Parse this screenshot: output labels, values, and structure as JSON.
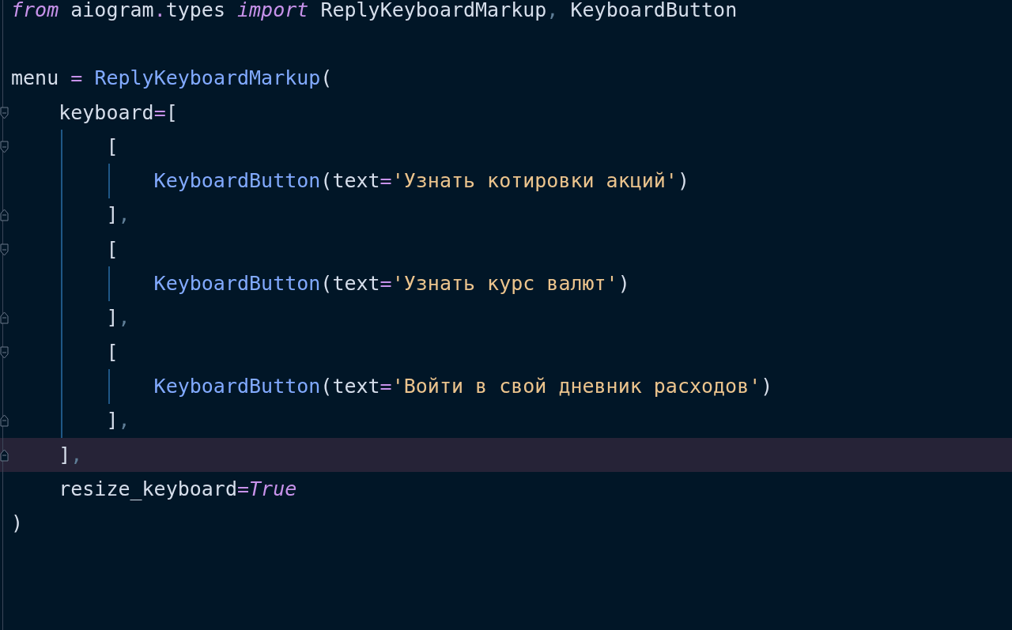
{
  "editor": {
    "lines": [
      {
        "fold_start": false,
        "fold_end": false,
        "current": false,
        "tokens": [
          {
            "kind": "keyword",
            "text": "from"
          },
          {
            "kind": "plain",
            "text": " aiogram"
          },
          {
            "kind": "op",
            "text": "."
          },
          {
            "kind": "plain",
            "text": "types "
          },
          {
            "kind": "keyword",
            "text": "import"
          },
          {
            "kind": "plain",
            "text": " ReplyKeyboardMarkup"
          },
          {
            "kind": "punct",
            "text": ","
          },
          {
            "kind": "plain",
            "text": " KeyboardButton"
          }
        ]
      },
      {
        "fold_start": false,
        "fold_end": false,
        "current": false
      },
      {
        "fold_start": false,
        "fold_end": false,
        "current": false,
        "tokens": [
          {
            "kind": "plain",
            "text": "menu "
          },
          {
            "kind": "op",
            "text": "="
          },
          {
            "kind": "func",
            "text": " ReplyKeyboardMarkup"
          },
          {
            "kind": "plain",
            "text": "("
          }
        ]
      },
      {
        "fold_start": true,
        "fold_end": false,
        "current": false,
        "tokens": [
          {
            "kind": "plain",
            "text": "    keyboard"
          },
          {
            "kind": "op",
            "text": "="
          },
          {
            "kind": "plain",
            "text": "["
          }
        ]
      },
      {
        "fold_start": true,
        "fold_end": false,
        "current": false,
        "tokens": [
          {
            "kind": "plain",
            "text": "        ["
          }
        ]
      },
      {
        "fold_start": false,
        "fold_end": false,
        "current": false,
        "tokens": [
          {
            "kind": "func",
            "text": "            KeyboardButton"
          },
          {
            "kind": "plain",
            "text": "(text"
          },
          {
            "kind": "op",
            "text": "="
          },
          {
            "kind": "string",
            "text": "'Узнать котировки акций'"
          },
          {
            "kind": "plain",
            "text": ")"
          }
        ]
      },
      {
        "fold_start": false,
        "fold_end": true,
        "current": false,
        "tokens": [
          {
            "kind": "plain",
            "text": "        ]"
          },
          {
            "kind": "punct",
            "text": ","
          }
        ]
      },
      {
        "fold_start": true,
        "fold_end": false,
        "current": false,
        "tokens": [
          {
            "kind": "plain",
            "text": "        ["
          }
        ]
      },
      {
        "fold_start": false,
        "fold_end": false,
        "current": false,
        "tokens": [
          {
            "kind": "func",
            "text": "            KeyboardButton"
          },
          {
            "kind": "plain",
            "text": "(text"
          },
          {
            "kind": "op",
            "text": "="
          },
          {
            "kind": "string",
            "text": "'Узнать курс валют'"
          },
          {
            "kind": "plain",
            "text": ")"
          }
        ]
      },
      {
        "fold_start": false,
        "fold_end": true,
        "current": false,
        "tokens": [
          {
            "kind": "plain",
            "text": "        ]"
          },
          {
            "kind": "punct",
            "text": ","
          }
        ]
      },
      {
        "fold_start": true,
        "fold_end": false,
        "current": false,
        "tokens": [
          {
            "kind": "plain",
            "text": "        ["
          }
        ]
      },
      {
        "fold_start": false,
        "fold_end": false,
        "current": false,
        "tokens": [
          {
            "kind": "func",
            "text": "            KeyboardButton"
          },
          {
            "kind": "plain",
            "text": "(text"
          },
          {
            "kind": "op",
            "text": "="
          },
          {
            "kind": "string",
            "text": "'Войти в свой дневник расходов'"
          },
          {
            "kind": "plain",
            "text": ")"
          }
        ]
      },
      {
        "fold_start": false,
        "fold_end": true,
        "current": false,
        "tokens": [
          {
            "kind": "plain",
            "text": "        ]"
          },
          {
            "kind": "punct",
            "text": ","
          }
        ]
      },
      {
        "fold_start": false,
        "fold_end": true,
        "current": true,
        "tokens": [
          {
            "kind": "plain",
            "text": "    ]"
          },
          {
            "kind": "punct",
            "text": ","
          }
        ]
      },
      {
        "fold_start": false,
        "fold_end": false,
        "current": false,
        "tokens": [
          {
            "kind": "plain",
            "text": "    resize_keyboard"
          },
          {
            "kind": "op",
            "text": "="
          },
          {
            "kind": "constant",
            "text": "True"
          }
        ]
      },
      {
        "fold_start": false,
        "fold_end": false,
        "current": false,
        "tokens": [
          {
            "kind": "plain",
            "text": ")"
          }
        ]
      }
    ]
  }
}
